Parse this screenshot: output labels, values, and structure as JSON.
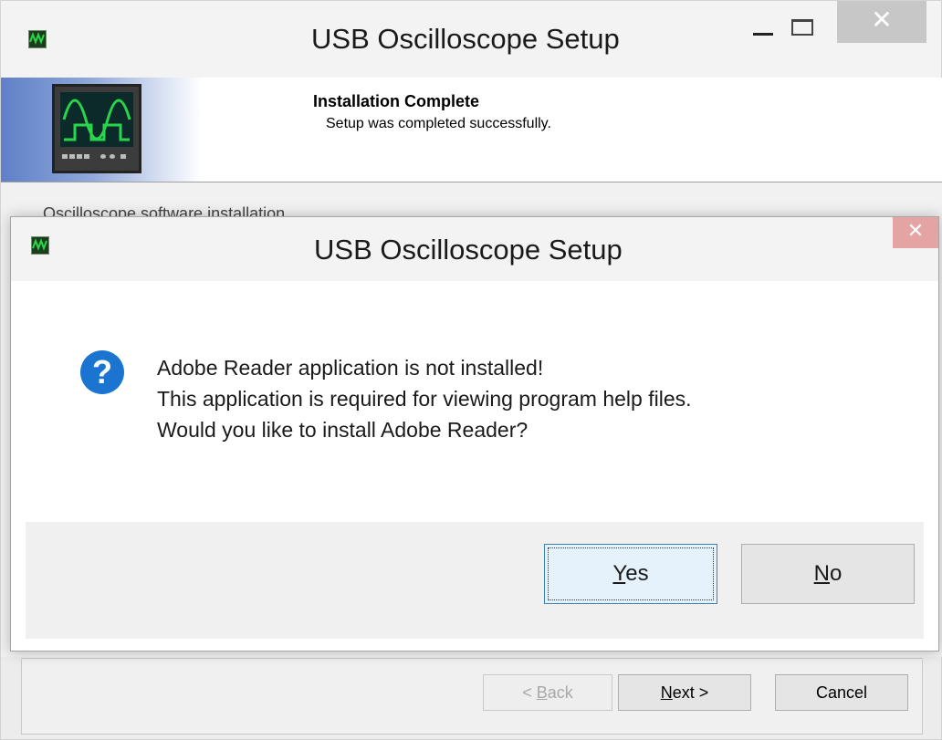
{
  "main_window": {
    "title": "USB Oscilloscope Setup",
    "close_glyph": "✕",
    "banner": {
      "title": "Installation Complete",
      "subtitle": "Setup was completed successfully."
    },
    "content_partial_text": "Oscilloscope software installation",
    "buttons": {
      "back_prefix": "< ",
      "back_access": "B",
      "back_rest": "ack",
      "next_access": "N",
      "next_rest": "ext >",
      "cancel": "Cancel"
    }
  },
  "dialog": {
    "title": "USB Oscilloscope Setup",
    "close_glyph": "✕",
    "icon": "question-icon",
    "icon_glyph": "?",
    "message_lines": [
      "Adobe Reader application is not installed!",
      "This application is required for viewing program help files.",
      "Would you like to install Adobe Reader?"
    ],
    "yes_access": "Y",
    "yes_rest": "es",
    "no_access": "N",
    "no_rest": "o"
  },
  "colors": {
    "accent_blue": "#1b75d0",
    "focus_border": "#3c7fb1",
    "scope_wave": "#29d64b"
  }
}
